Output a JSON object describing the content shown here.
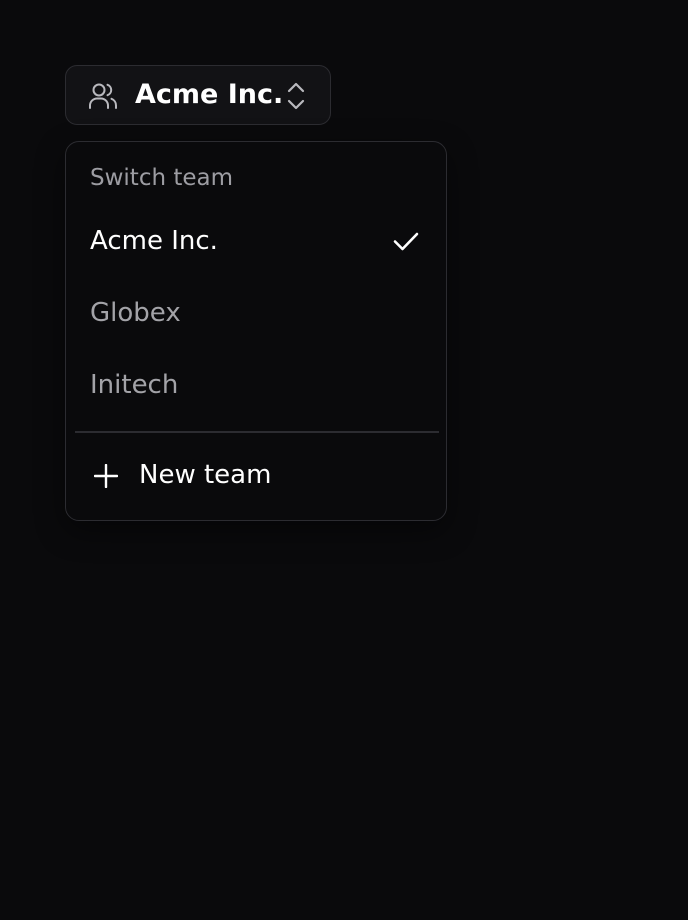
{
  "switcher": {
    "current_team": "Acme Inc.",
    "icon": "users-icon",
    "chevron_icon": "chevron-up-down-icon"
  },
  "menu": {
    "label": "Switch team",
    "items": [
      {
        "label": "Acme Inc.",
        "selected": true
      },
      {
        "label": "Globex",
        "selected": false
      },
      {
        "label": "Initech",
        "selected": false
      }
    ],
    "selected_icon": "check-icon",
    "new_team": {
      "label": "New team",
      "icon": "plus-icon"
    }
  },
  "colors": {
    "background": "#0a0a0c",
    "border": "#2c2c31",
    "text_primary": "#ffffff",
    "text_muted": "#a3a3a8",
    "label_muted": "#9d9da3"
  }
}
